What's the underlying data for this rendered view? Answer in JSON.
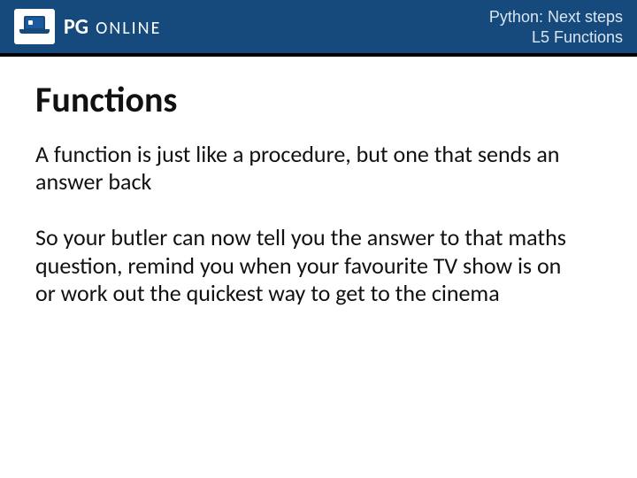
{
  "header": {
    "brand_pg": "PG",
    "brand_online": "ONLINE",
    "line1": "Python: Next steps",
    "line2": "L5 Functions"
  },
  "slide": {
    "title": "Functions",
    "para1": "A function is just like a procedure, but one that sends an answer back",
    "para2": "So your butler can now tell you the answer to that maths question, remind you when your favourite TV show is on or work out the quickest way to get to the cinema"
  }
}
